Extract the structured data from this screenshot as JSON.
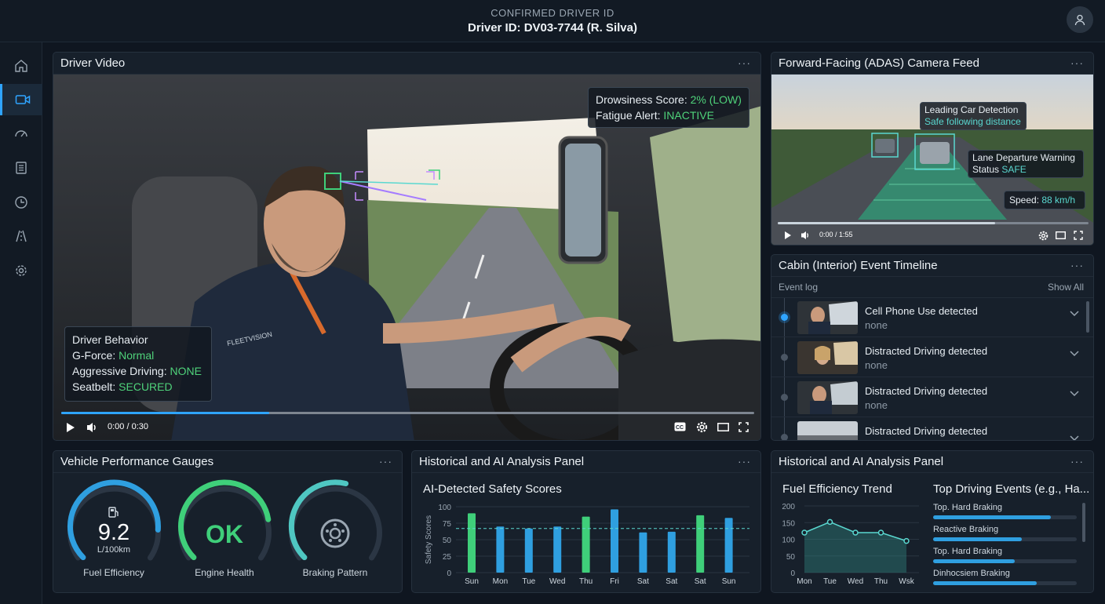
{
  "header": {
    "caption": "CONFIRMED DRIVER ID",
    "driver_id": "Driver ID: DV03-7744 (R. Silva)",
    "avatar_icon": "user-icon"
  },
  "sidebar": {
    "items": [
      {
        "icon": "home-icon",
        "active": false
      },
      {
        "icon": "video-camera-icon",
        "active": true
      },
      {
        "icon": "speedometer-icon",
        "active": false
      },
      {
        "icon": "report-icon",
        "active": false
      },
      {
        "icon": "history-clock-icon",
        "active": false
      },
      {
        "icon": "road-icon",
        "active": false
      },
      {
        "icon": "gear-icon",
        "active": false
      }
    ]
  },
  "driver_video": {
    "title": "Driver Video",
    "menu": "···",
    "drowsiness_label": "Drowsiness Score: ",
    "drowsiness_value": "2% (LOW)",
    "fatigue_label": "Fatigue Alert: ",
    "fatigue_value": "INACTIVE",
    "behavior": {
      "title": "Driver Behavior",
      "gforce_label": "G-Force: ",
      "gforce_value": "Normal",
      "aggressive_label": "Aggressive Driving: ",
      "aggressive_value": "NONE",
      "seatbelt_label": "Seatbelt: ",
      "seatbelt_value": "SECURED"
    },
    "shirt_logo": "FLEETVISION",
    "time": "0:00 / 0:30",
    "progress": 0.3
  },
  "adas": {
    "title": "Forward-Facing (ADAS) Camera Feed",
    "menu": "···",
    "leading_title": "Leading Car Detection",
    "leading_status": "Safe following distance",
    "lane_title": "Lane Departure Warning",
    "lane_status_label": "Status ",
    "lane_status_value": "SAFE",
    "speed_label": "Speed: ",
    "speed_value": "88 km/h",
    "time": "0:00 / 1:55",
    "progress": 0.7
  },
  "timeline": {
    "title": "Cabin (Interior) Event Timeline",
    "menu": "···",
    "log_label": "Event log",
    "show_all": "Show All",
    "events": [
      {
        "title": "Cell Phone Use detected",
        "sub": "none"
      },
      {
        "title": "Distracted Driving detected",
        "sub": "none"
      },
      {
        "title": "Distracted Driving detected",
        "sub": "none"
      },
      {
        "title": "Distracted Driving detected",
        "sub": ""
      }
    ]
  },
  "gauges": {
    "title": "Vehicle Performance Gauges",
    "menu": "···",
    "fuel_value": "9.2",
    "fuel_unit": "L/100km",
    "fuel_label": "Fuel Efficiency",
    "fuel_fill": 0.85,
    "engine_value": "OK",
    "engine_label": "Engine Health",
    "engine_fill": 0.8,
    "braking_label": "Braking Pattern",
    "braking_fill": 0.55,
    "colors": {
      "fuel": "#2f9fe0",
      "engine": "#3fcf7a",
      "braking": "#4fc7c2"
    }
  },
  "safety_panel": {
    "title": "Historical and AI Analysis Panel",
    "menu": "···",
    "subtitle": "AI-Detected Safety Scores"
  },
  "fuel_panel": {
    "title": "Historical and AI Analysis Panel",
    "menu": "···",
    "fuel_title": "Fuel Efficiency Trend",
    "events_title": "Top Driving Events (e.g., Ha...",
    "events": [
      {
        "label": "Top. Hard Braking",
        "value": 0.82
      },
      {
        "label": "Reactive Braking",
        "value": 0.62
      },
      {
        "label": "Top. Hard Braking",
        "value": 0.57
      },
      {
        "label": "Dinhocsiem Braking",
        "value": 0.72
      }
    ]
  },
  "chart_data": [
    {
      "type": "bar",
      "title": "AI-Detected Safety Scores",
      "ylabel": "Safety Scores",
      "ylim": [
        0,
        100
      ],
      "yticks": [
        0,
        25,
        50,
        75,
        100
      ],
      "categories": [
        "Sun",
        "Mon",
        "Tue",
        "Wed",
        "Thu",
        "Fri",
        "Sat",
        "Sat",
        "Sat",
        "Sun"
      ],
      "values": [
        90,
        70,
        67,
        70,
        85,
        96,
        61,
        62,
        87,
        83
      ],
      "bar_colors": [
        "#3fcf7a",
        "#2f9fe0",
        "#2f9fe0",
        "#2f9fe0",
        "#3fcf7a",
        "#2f9fe0",
        "#2f9fe0",
        "#2f9fe0",
        "#3fcf7a",
        "#2f9fe0"
      ],
      "reference_line": 67,
      "grid": true
    },
    {
      "type": "area",
      "title": "Fuel Efficiency Trend",
      "ylim": [
        0,
        200
      ],
      "yticks": [
        0,
        50,
        100,
        150,
        200
      ],
      "categories": [
        "Mon",
        "Tue",
        "Wed",
        "Thu",
        "Wsk"
      ],
      "values": [
        120,
        152,
        120,
        120,
        95
      ],
      "grid": true
    }
  ]
}
